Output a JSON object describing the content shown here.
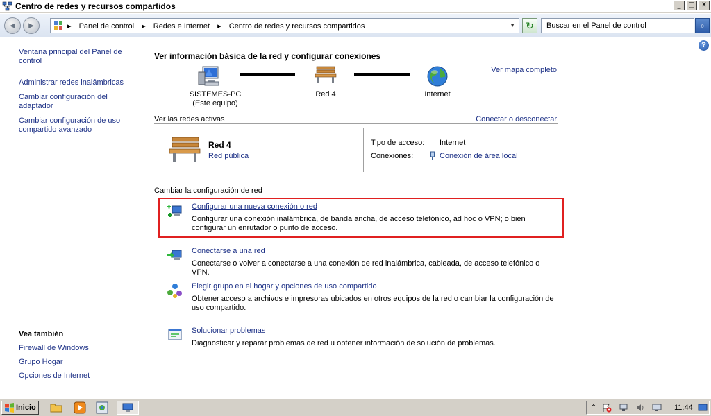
{
  "window": {
    "title": "Centro de redes y recursos compartidos",
    "min_label": "_",
    "max_label": "□",
    "close_label": "✕"
  },
  "nav": {
    "back_label": "◄",
    "forward_label": "►"
  },
  "address": {
    "crumbs": [
      "▸",
      "Panel de control",
      "▸",
      "Redes e Internet",
      "▸",
      "Centro de redes y recursos compartidos"
    ],
    "dropdown_glyph": "▼"
  },
  "refresh_glyph": "↻",
  "search": {
    "placeholder": "Buscar en el Panel de control",
    "button_glyph": "⌕"
  },
  "help_glyph": "?",
  "sidebar": {
    "items": [
      {
        "label": "Ventana principal del Panel de control"
      },
      {
        "label": "Administrar redes inalámbricas"
      },
      {
        "label": "Cambiar configuración del adaptador"
      },
      {
        "label": "Cambiar configuración de uso compartido avanzado"
      }
    ],
    "see_also": {
      "title": "Vea también",
      "items": [
        {
          "label": "Firewall de Windows"
        },
        {
          "label": "Grupo Hogar"
        },
        {
          "label": "Opciones de Internet"
        }
      ]
    }
  },
  "main": {
    "heading": "Ver información básica de la red y configurar conexiones",
    "map": {
      "computer_name": "SISTEMES-PC",
      "computer_sub": "(Este equipo)",
      "network_name": "Red  4",
      "internet_label": "Internet",
      "full_map_link": "Ver mapa completo"
    },
    "active": {
      "section_label": "Ver las redes activas",
      "connect_link": "Conectar o desconectar",
      "network_name": "Red  4",
      "network_type": "Red pública",
      "access_label": "Tipo de acceso:",
      "access_value": "Internet",
      "connections_label": "Conexiones:",
      "connections_value": "Conexión de área local"
    },
    "change": {
      "section_label": "Cambiar la configuración de red",
      "tasks": [
        {
          "title": "Configurar una nueva conexión o red",
          "desc": "Configurar una conexión inalámbrica, de banda ancha, de acceso telefónico, ad hoc o VPN; o bien configurar un enrutador o punto de acceso."
        },
        {
          "title": "Conectarse a una red",
          "desc": "Conectarse o volver a conectarse a una conexión de red inalámbrica, cableada, de acceso telefónico o VPN."
        },
        {
          "title": "Elegir grupo en el hogar y opciones de uso compartido",
          "desc": "Obtener acceso a archivos e impresoras ubicados en otros equipos de la red o cambiar la configuración de uso compartido."
        },
        {
          "title": "Solucionar problemas",
          "desc": "Diagnosticar y reparar problemas de red u obtener información de solución de problemas."
        }
      ]
    }
  },
  "taskbar": {
    "start_label": "Inicio",
    "tray_expand_glyph": "⌃",
    "clock": "11:44"
  }
}
